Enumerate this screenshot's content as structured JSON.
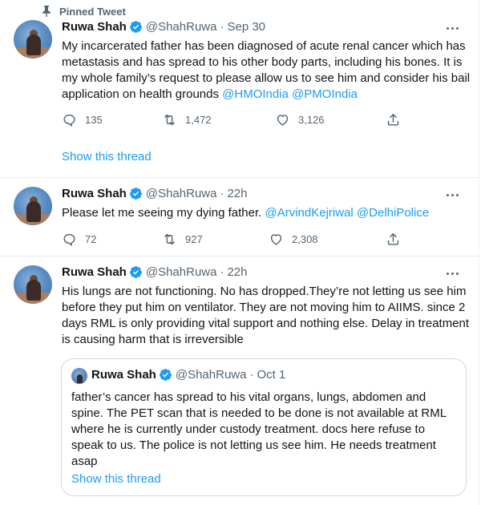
{
  "colors": {
    "accent": "#1d9bf0",
    "text": "#0f1419",
    "secondary": "#536471",
    "border": "#e6ecf0"
  },
  "pinned_label": "Pinned Tweet",
  "tweets": [
    {
      "name": "Ruwa Shah",
      "handle": "@ShahRuwa",
      "dot": "·",
      "time": "Sep 30",
      "text": "My incarcerated father has been diagnosed of acute renal cancer which has metastasis and has spread to his other body parts, including his bones. It is my whole family’s request to please allow us to see him and consider his bail application on health grounds",
      "mentions": [
        "@HMOIndia",
        "@PMOIndia"
      ],
      "replies": "135",
      "retweets": "1,472",
      "likes": "3,126",
      "show_thread": "Show this thread"
    },
    {
      "name": "Ruwa Shah",
      "handle": "@ShahRuwa",
      "dot": "·",
      "time": "22h",
      "text": "Please let me seeing my dying father.",
      "mentions": [
        "@ArvindKejriwal",
        "@DelhiPolice"
      ],
      "replies": "72",
      "retweets": "927",
      "likes": "2,308"
    },
    {
      "name": "Ruwa Shah",
      "handle": "@ShahRuwa",
      "dot": "·",
      "time": "22h",
      "text": "His lungs are not functioning. No has dropped.They’re not letting us see him before they put him on ventilator. They are not moving him to AIIMS. since 2 days RML is only providing vital support and nothing else. Delay in treatment is causing harm that is irreversible",
      "quote": {
        "name": "Ruwa Shah",
        "handle": "@ShahRuwa",
        "dot": "·",
        "time": "Oct 1",
        "text": "father’s cancer has spread to his vital organs, lungs, abdomen and spine. The PET scan that is needed to be done is not available at RML where he is currently under custody treatment. docs here refuse to speak to us. The police is not letting us see him. He needs treatment asap",
        "show_thread": "Show this thread"
      }
    }
  ],
  "icons": [
    "pin-icon",
    "verified-icon",
    "reply-icon",
    "retweet-icon",
    "like-icon",
    "share-icon",
    "more-icon"
  ]
}
